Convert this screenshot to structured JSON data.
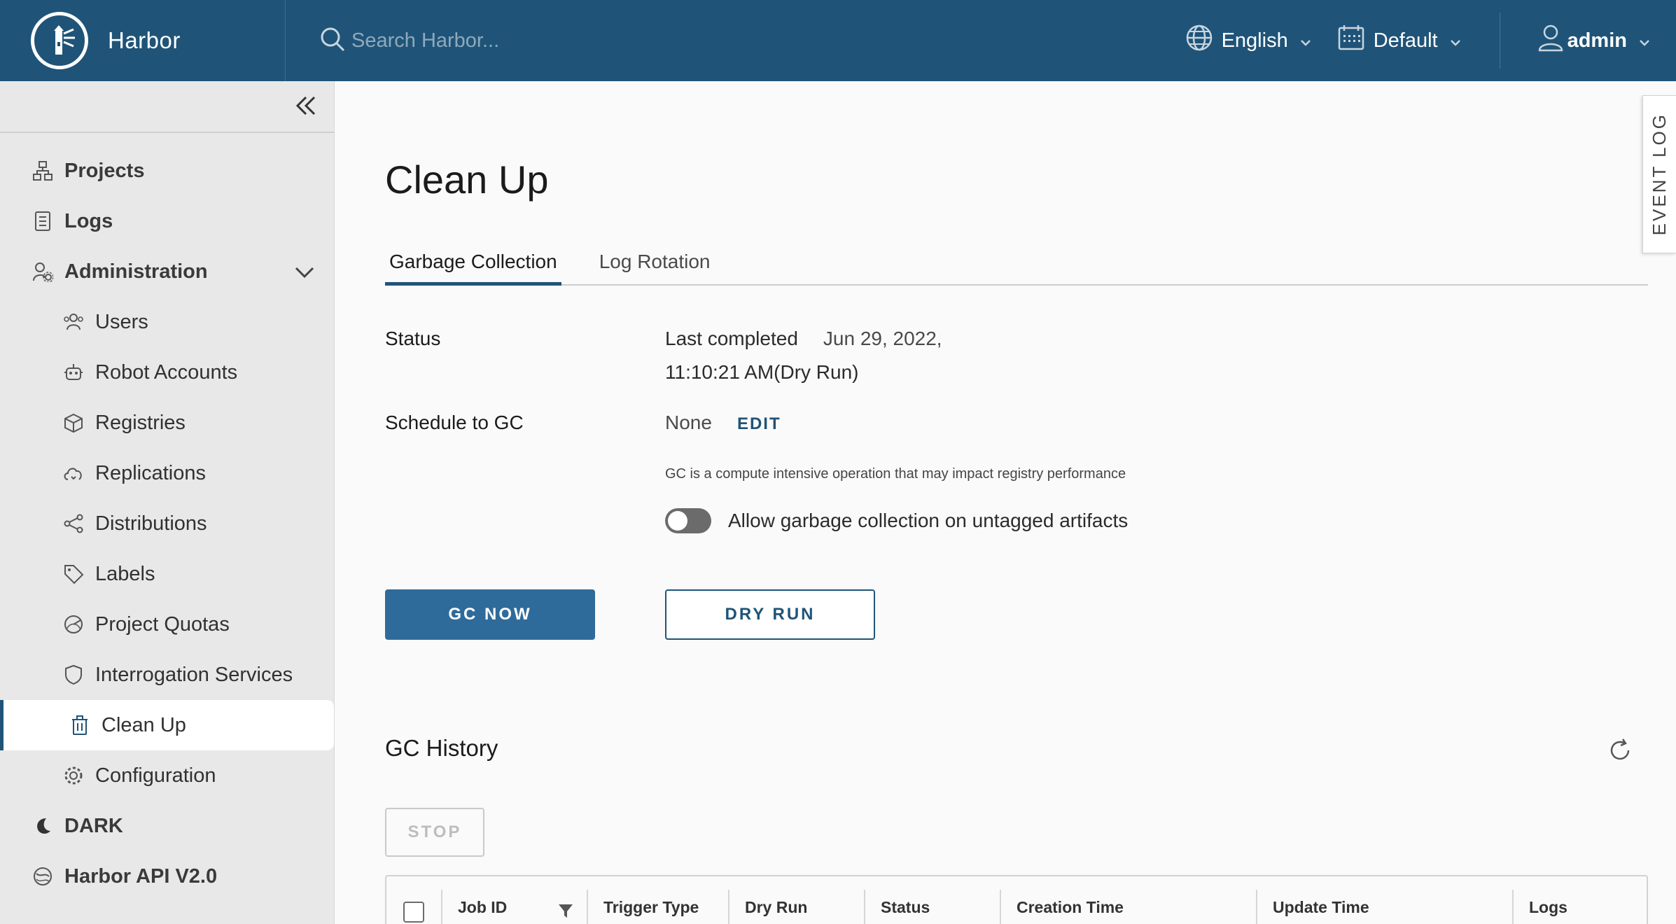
{
  "header": {
    "brand": "Harbor",
    "search_placeholder": "Search Harbor...",
    "language": "English",
    "theme": "Default",
    "user": "admin",
    "bg_color": "#1f5478"
  },
  "sidebar": {
    "items": [
      {
        "label": "Projects",
        "icon": "projects-icon"
      },
      {
        "label": "Logs",
        "icon": "logs-icon"
      },
      {
        "label": "Administration",
        "icon": "administration-icon"
      },
      {
        "label": "Users",
        "icon": "users-icon"
      },
      {
        "label": "Robot Accounts",
        "icon": "robot-icon"
      },
      {
        "label": "Registries",
        "icon": "registries-icon"
      },
      {
        "label": "Replications",
        "icon": "replications-icon"
      },
      {
        "label": "Distributions",
        "icon": "distributions-icon"
      },
      {
        "label": "Labels",
        "icon": "labels-icon"
      },
      {
        "label": "Project Quotas",
        "icon": "quotas-icon"
      },
      {
        "label": "Interrogation Services",
        "icon": "shield-icon"
      },
      {
        "label": "Clean Up",
        "icon": "trash-icon"
      },
      {
        "label": "Configuration",
        "icon": "gear-icon"
      },
      {
        "label": "DARK",
        "icon": "moon-icon"
      },
      {
        "label": "Harbor API V2.0",
        "icon": "api-icon"
      }
    ],
    "active": "Clean Up"
  },
  "main": {
    "title": "Clean Up",
    "tabs": [
      {
        "label": "Garbage Collection",
        "active": true
      },
      {
        "label": "Log Rotation",
        "active": false
      }
    ],
    "status_label": "Status",
    "last_completed_label": "Last completed",
    "last_completed_date": "Jun 29, 2022,",
    "last_completed_time": "11:10:21 AM(Dry Run)",
    "schedule_label": "Schedule to GC",
    "schedule_value": "None",
    "edit_label": "EDIT",
    "note": "GC is a compute intensive operation that may impact registry performance",
    "toggle_label": "Allow garbage collection on untagged artifacts",
    "toggle_on": false,
    "gc_now_label": "GC NOW",
    "dry_run_label": "DRY RUN",
    "history_title": "GC History",
    "stop_label": "STOP",
    "table_columns": [
      "Job ID",
      "Trigger Type",
      "Dry Run",
      "Status",
      "Creation Time",
      "Update Time",
      "Logs"
    ]
  },
  "event_log_label": "EVENT LOG"
}
